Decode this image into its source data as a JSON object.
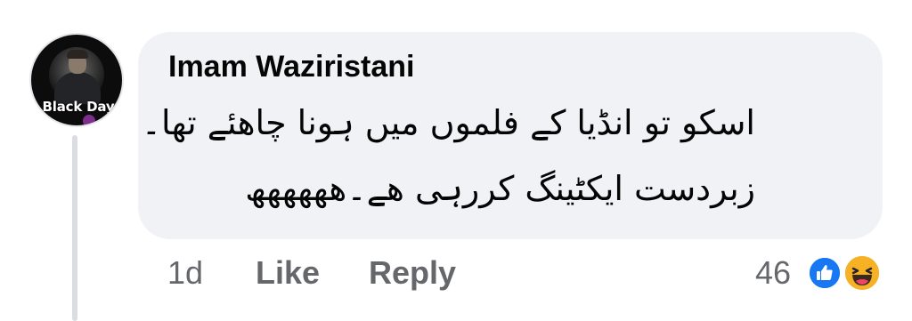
{
  "comment": {
    "author": "Imam Waziristani",
    "text_line1": "اسکو تو انڈیا کے فلموں میں ہونا چاھئے تھا۔",
    "text_line2": "زبردست ایکٹینگ کررہی ھے۔ھھھھھھ",
    "avatar": {
      "badge_text": "Black Day"
    }
  },
  "actions": {
    "timestamp": "1d",
    "like_label": "Like",
    "reply_label": "Reply"
  },
  "reactions": {
    "count": "46",
    "icons": [
      "like-icon",
      "haha-icon"
    ]
  },
  "colors": {
    "bubble": "#f0f2f5",
    "text": "#050505",
    "secondary_text": "#65676b",
    "like_blue": "#1877f2",
    "haha_yellow": "#f7b125"
  }
}
